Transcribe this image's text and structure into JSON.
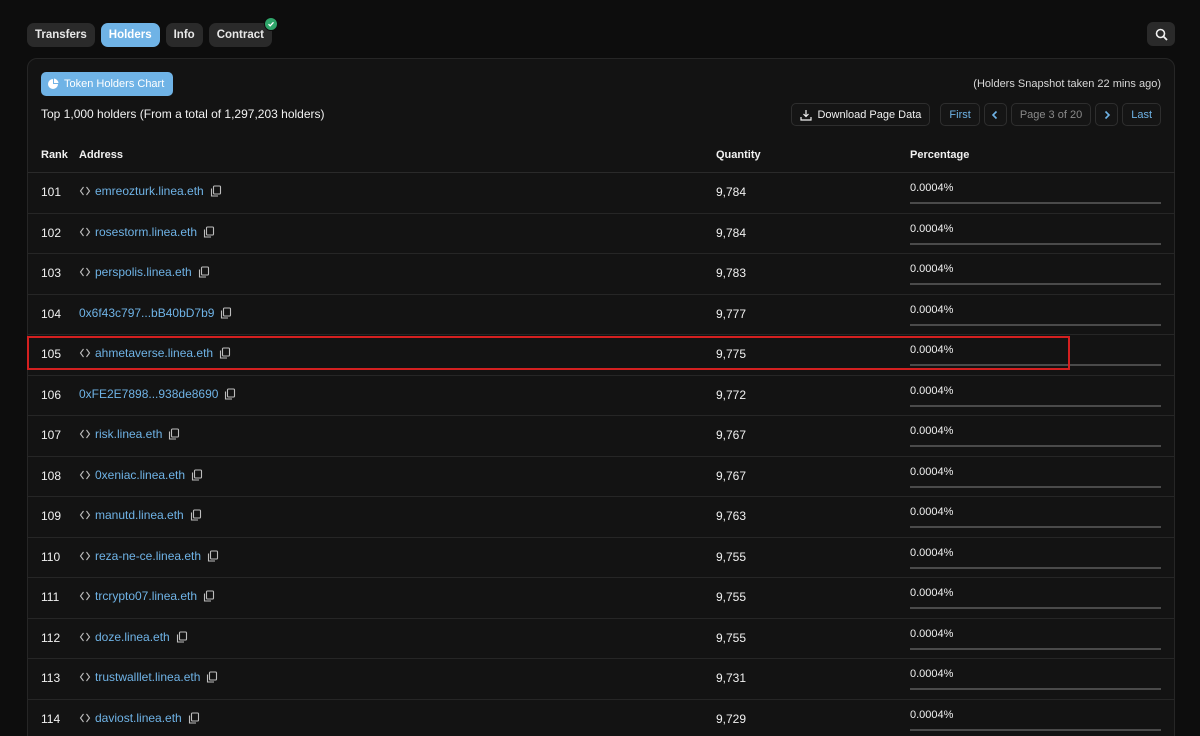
{
  "tabs": [
    {
      "label": "Transfers",
      "active": false
    },
    {
      "label": "Holders",
      "active": true
    },
    {
      "label": "Info",
      "active": false
    },
    {
      "label": "Contract",
      "active": false,
      "verified": true
    }
  ],
  "chart_button_label": "Token Holders Chart",
  "snapshot_text": "(Holders Snapshot taken 22 mins ago)",
  "summary_text": "Top 1,000 holders (From a total of 1,297,203 holders)",
  "pager": {
    "download_label": "Download Page Data",
    "first_label": "First",
    "page_info": "Page 3 of 20",
    "last_label": "Last"
  },
  "table": {
    "headers": {
      "rank": "Rank",
      "address": "Address",
      "quantity": "Quantity",
      "percentage": "Percentage"
    },
    "rows": [
      {
        "rank": "101",
        "address": "emreozturk.linea.eth",
        "ens": true,
        "quantity": "9,784",
        "percentage": "0.0004%"
      },
      {
        "rank": "102",
        "address": "rosestorm.linea.eth",
        "ens": true,
        "quantity": "9,784",
        "percentage": "0.0004%"
      },
      {
        "rank": "103",
        "address": "perspolis.linea.eth",
        "ens": true,
        "quantity": "9,783",
        "percentage": "0.0004%"
      },
      {
        "rank": "104",
        "address": "0x6f43c797...bB40bD7b9",
        "ens": false,
        "quantity": "9,777",
        "percentage": "0.0004%"
      },
      {
        "rank": "105",
        "address": "ahmetaverse.linea.eth",
        "ens": true,
        "quantity": "9,775",
        "percentage": "0.0004%"
      },
      {
        "rank": "106",
        "address": "0xFE2E7898...938de8690",
        "ens": false,
        "quantity": "9,772",
        "percentage": "0.0004%"
      },
      {
        "rank": "107",
        "address": "risk.linea.eth",
        "ens": true,
        "quantity": "9,767",
        "percentage": "0.0004%"
      },
      {
        "rank": "108",
        "address": "0xeniac.linea.eth",
        "ens": true,
        "quantity": "9,767",
        "percentage": "0.0004%"
      },
      {
        "rank": "109",
        "address": "manutd.linea.eth",
        "ens": true,
        "quantity": "9,763",
        "percentage": "0.0004%"
      },
      {
        "rank": "110",
        "address": "reza-ne-ce.linea.eth",
        "ens": true,
        "quantity": "9,755",
        "percentage": "0.0004%"
      },
      {
        "rank": "111",
        "address": "trcrypto07.linea.eth",
        "ens": true,
        "quantity": "9,755",
        "percentage": "0.0004%"
      },
      {
        "rank": "112",
        "address": "doze.linea.eth",
        "ens": true,
        "quantity": "9,755",
        "percentage": "0.0004%"
      },
      {
        "rank": "113",
        "address": "trustwalllet.linea.eth",
        "ens": true,
        "quantity": "9,731",
        "percentage": "0.0004%"
      },
      {
        "rank": "114",
        "address": "daviost.linea.eth",
        "ens": true,
        "quantity": "9,729",
        "percentage": "0.0004%"
      }
    ]
  },
  "highlighted_rank": "105",
  "colors": {
    "accent": "#6fb3e6",
    "background": "#0d0d0d",
    "card": "#131313",
    "highlight": "#d42020",
    "verified": "#2fa56a"
  },
  "icons": {
    "search": "search-icon",
    "chart": "pie-chart-icon",
    "download": "download-icon",
    "ens": "ens-icon",
    "copy": "copy-icon",
    "verified": "verified-check-icon"
  }
}
